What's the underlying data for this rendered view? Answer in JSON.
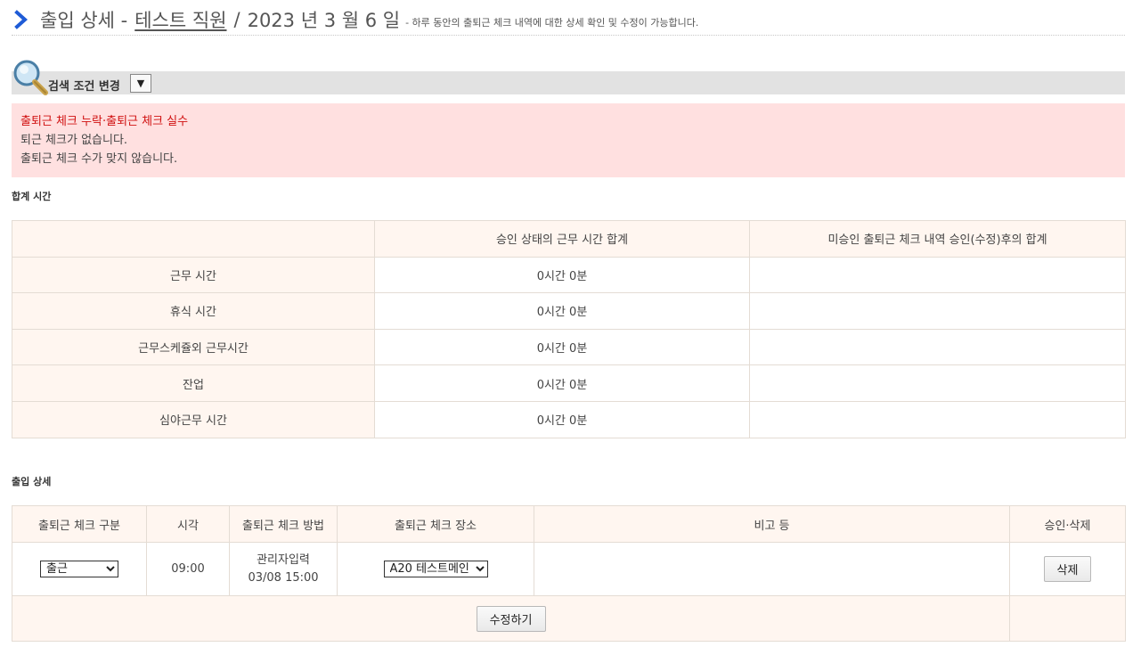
{
  "header": {
    "title": "출입 상세 -",
    "employee": "테스트 직원",
    "separator": "/",
    "date": "2023 년 3 월 6 일",
    "note": "- 하루 동안의 출퇴근 체크 내역에 대한 상세 확인 및 수정이 가능합니다."
  },
  "search": {
    "label": "검색 조건 변경",
    "toggle_symbol": "▼"
  },
  "alert": {
    "title": "출퇴근 체크 누락·출퇴근 체크 실수",
    "lines": [
      "퇴근 체크가 없습니다.",
      "출퇴근 체크 수가 맞지 않습니다."
    ]
  },
  "totals": {
    "section_title": "합계 시간",
    "headers": [
      "",
      "승인 상태의 근무 시간 합계",
      "미승인 출퇴근 체크 내역 승인(수정)후의 합계"
    ],
    "rows": [
      {
        "label": "근무 시간",
        "approved": "0시간 0분",
        "after": ""
      },
      {
        "label": "휴식 시간",
        "approved": "0시간 0분",
        "after": ""
      },
      {
        "label": "근무스케쥴외 근무시간",
        "approved": "0시간 0분",
        "after": ""
      },
      {
        "label": "잔업",
        "approved": "0시간 0분",
        "after": ""
      },
      {
        "label": "심야근무 시간",
        "approved": "0시간 0분",
        "after": ""
      }
    ]
  },
  "detail": {
    "section_title": "출입 상세",
    "headers": [
      "출퇴근 체크 구분",
      "시각",
      "출퇴근 체크 방법",
      "출퇴근 체크 장소",
      "비고 등",
      "승인·삭제"
    ],
    "row": {
      "type_selected": "출근",
      "time": "09:00",
      "method_line1": "관리자입력",
      "method_line2": "03/08 15:00",
      "location_selected": "A20 테스트메인",
      "note": "",
      "delete_label": "삭제"
    },
    "edit_label": "수정하기"
  },
  "colors": {
    "accent_chevron": "#1e5bd6",
    "alert_bg": "#ffe0e0",
    "alert_title": "#d01010",
    "table_tint": "#fff6f0",
    "search_bar_bg": "#e2e2e2"
  }
}
